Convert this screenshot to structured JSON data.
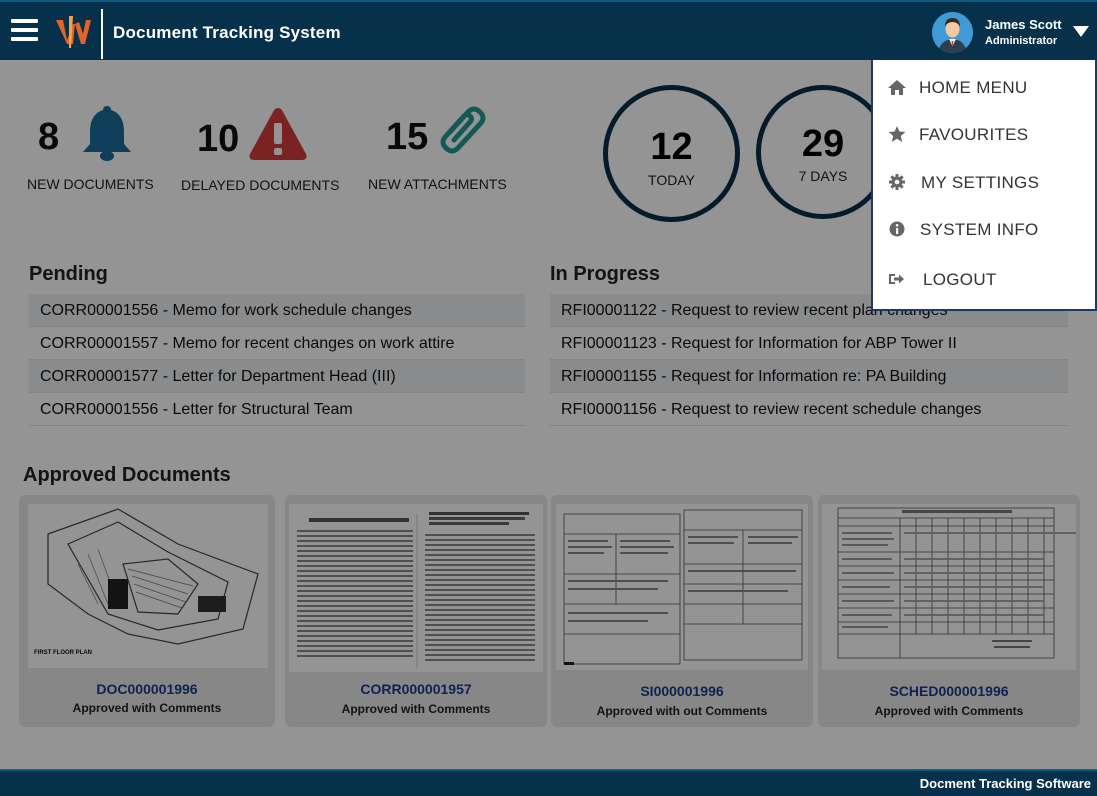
{
  "header": {
    "app_title": "Document Tracking System",
    "user_name": "James Scott",
    "user_role": "Administrator",
    "colors": {
      "bar": "#07304a",
      "accent": "#e2642a"
    }
  },
  "stats": [
    {
      "value": "8",
      "label": "NEW DOCUMENTS",
      "icon": "bell-icon",
      "color": "#1b6b9b"
    },
    {
      "value": "10",
      "label": "DELAYED DOCUMENTS",
      "icon": "warning-icon",
      "color": "#d43c3c"
    },
    {
      "value": "15",
      "label": "NEW ATTACHMENTS",
      "icon": "paperclip-icon",
      "color": "#1e9a8e"
    }
  ],
  "counters": [
    {
      "value": "12",
      "label": "TODAY"
    },
    {
      "value": "29",
      "label": "7 DAYS"
    }
  ],
  "pending": {
    "title": "Pending",
    "items": [
      "CORR00001556 - Memo for work schedule changes",
      "CORR00001557 - Memo for recent changes on work attire",
      "CORR00001577 - Letter for Department Head (III)",
      "CORR00001556 - Letter for Structural Team"
    ]
  },
  "in_progress": {
    "title": "In Progress",
    "items": [
      "RFI00001122 - Request to review recent plan changes",
      "RFI00001123 - Request for Information for ABP Tower II",
      "RFI00001155 - Request for Information re: PA Building",
      "RFI00001156 - Request to review recent schedule changes"
    ]
  },
  "approved": {
    "title": "Approved Documents",
    "cards": [
      {
        "code": "DOC000001996",
        "status": "Approved with Comments",
        "thumb_caption": "FIRST FLOOR PLAN"
      },
      {
        "code": "CORR000001957",
        "status": "Approved with Comments"
      },
      {
        "code": "SI000001996",
        "status": "Approved with out Comments"
      },
      {
        "code": "SCHED000001996",
        "status": "Approved with Comments"
      }
    ]
  },
  "user_menu": {
    "items": [
      {
        "label": "HOME MENU",
        "icon": "home-icon"
      },
      {
        "label": "FAVOURITES",
        "icon": "star-icon"
      },
      {
        "label": "MY SETTINGS",
        "icon": "gear-icon"
      },
      {
        "label": "SYSTEM INFO",
        "icon": "info-icon"
      },
      {
        "label": "LOGOUT",
        "icon": "logout-icon"
      }
    ]
  },
  "footer": {
    "text": "Docment Tracking Software"
  }
}
